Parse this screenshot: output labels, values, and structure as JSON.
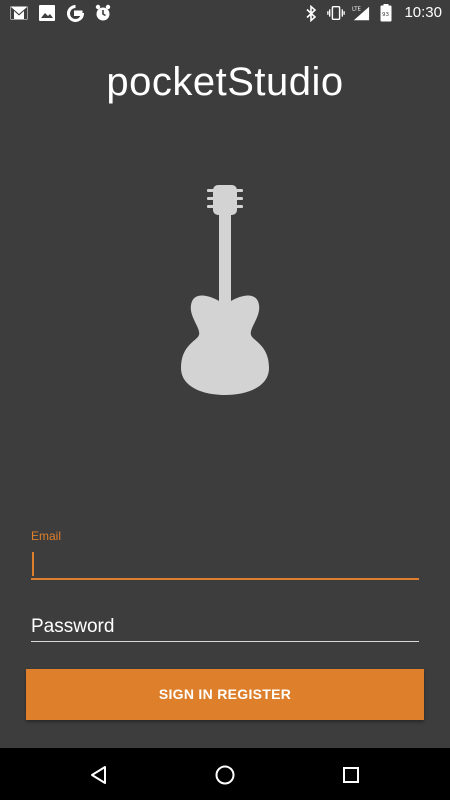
{
  "status_bar": {
    "time": "10:30",
    "left_icons": [
      "gmail-icon",
      "image-icon",
      "google-icon",
      "alarm-icon"
    ],
    "right_icons": [
      "bluetooth-icon",
      "vibrate-icon",
      "lte-signal-icon",
      "battery-icon"
    ]
  },
  "app": {
    "title": "pocketStudio",
    "logo": "guitar-icon"
  },
  "form": {
    "email_label": "Email",
    "email_value": "",
    "password_placeholder": "Password",
    "submit_label": "SIGN IN REGISTER"
  },
  "nav_bar": {
    "buttons": [
      "back-icon",
      "home-icon",
      "recents-icon"
    ]
  },
  "colors": {
    "background": "#3d3d3d",
    "accent": "#de7f2b",
    "logo": "#d3d3d3"
  }
}
